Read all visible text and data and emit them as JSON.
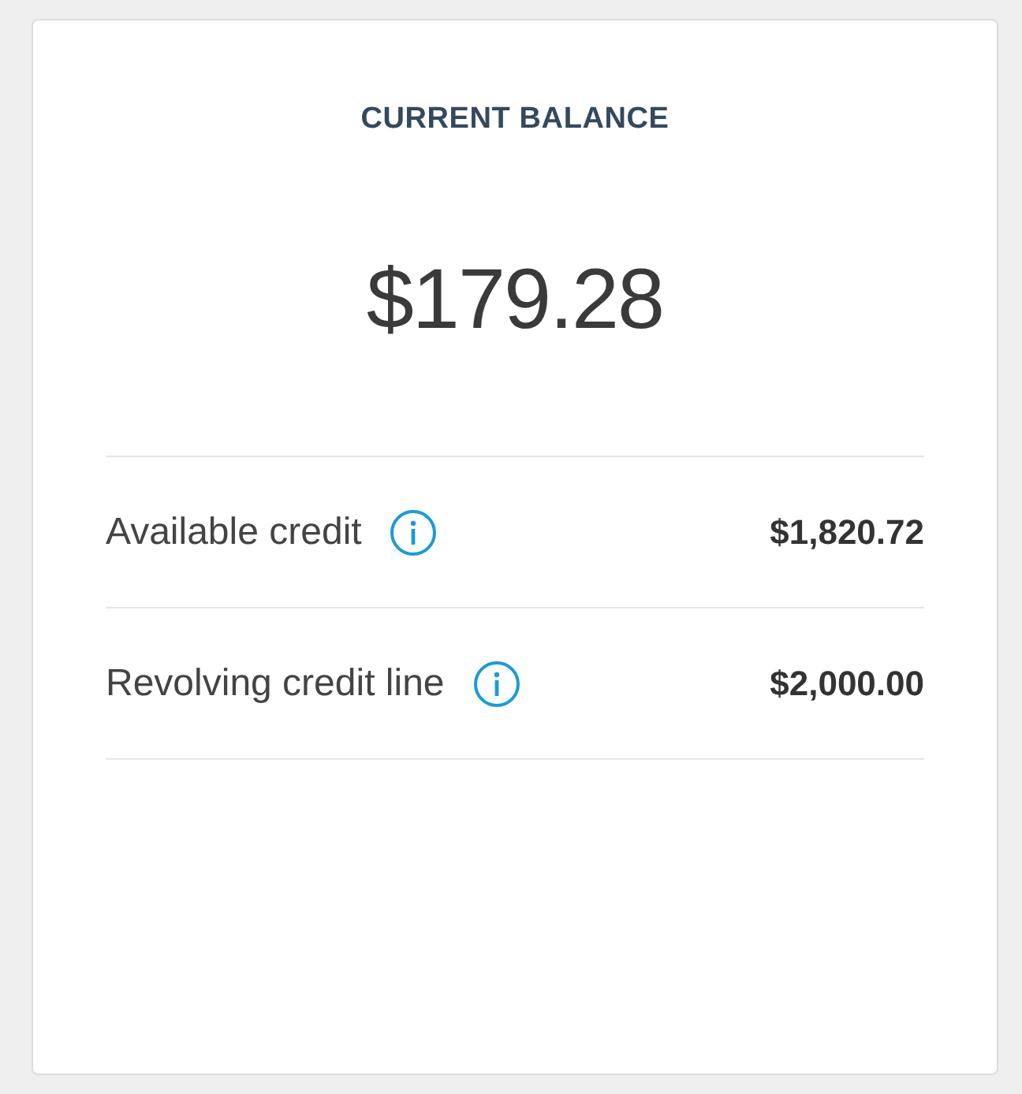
{
  "card": {
    "title": "CURRENT BALANCE",
    "balance": "$179.28",
    "rows": [
      {
        "label": "Available credit",
        "value": "$1,820.72"
      },
      {
        "label": "Revolving credit line",
        "value": "$2,000.00"
      }
    ]
  }
}
